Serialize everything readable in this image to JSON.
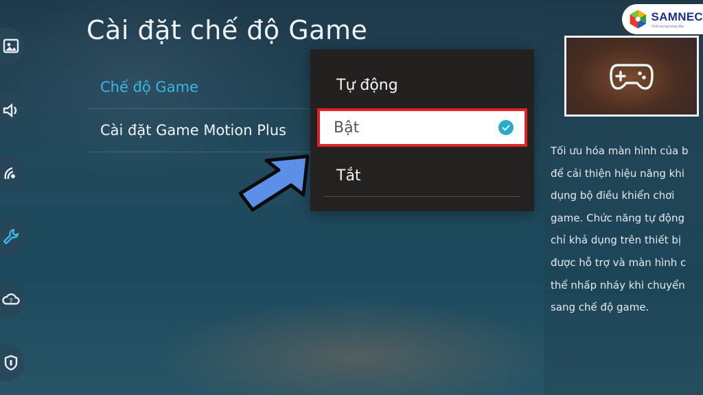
{
  "page": {
    "title": "Cài đặt chế độ Game"
  },
  "sidebar": {
    "icons": [
      "picture-icon",
      "sound-icon",
      "broadcast-icon",
      "wrench-icon",
      "support-cloud-icon",
      "shield-icon"
    ],
    "active_icon": "wrench-icon"
  },
  "menu": {
    "items": [
      {
        "label": "Chế độ Game",
        "state": "selected"
      },
      {
        "label": "Cài đặt Game Motion Plus",
        "state": "normal"
      }
    ]
  },
  "dropdown": {
    "options": [
      {
        "label": "Tự động"
      },
      {
        "label": "Bật",
        "selected": true
      },
      {
        "label": "Tắt"
      }
    ]
  },
  "info_panel": {
    "preview_icon": "gamepad-icon",
    "description": "Tối ưu hóa màn hình của b\nđể cải thiện hiệu năng khi\ndụng bộ điều khiển chơi\ngame. Chức năng tự động\nchỉ khả dụng trên thiết bị\nđược hỗ trợ và màn hình c\nthể nhấp nháy khi chuyển\nsang chế độ game."
  },
  "logo": {
    "name": "SAMNEC",
    "tagline": "Chất lượng hàng đầu"
  },
  "colors": {
    "accent": "#39b7e5",
    "highlight_border": "#e02424",
    "check": "#2aa9c9",
    "arrow": "#5b8fe8"
  }
}
